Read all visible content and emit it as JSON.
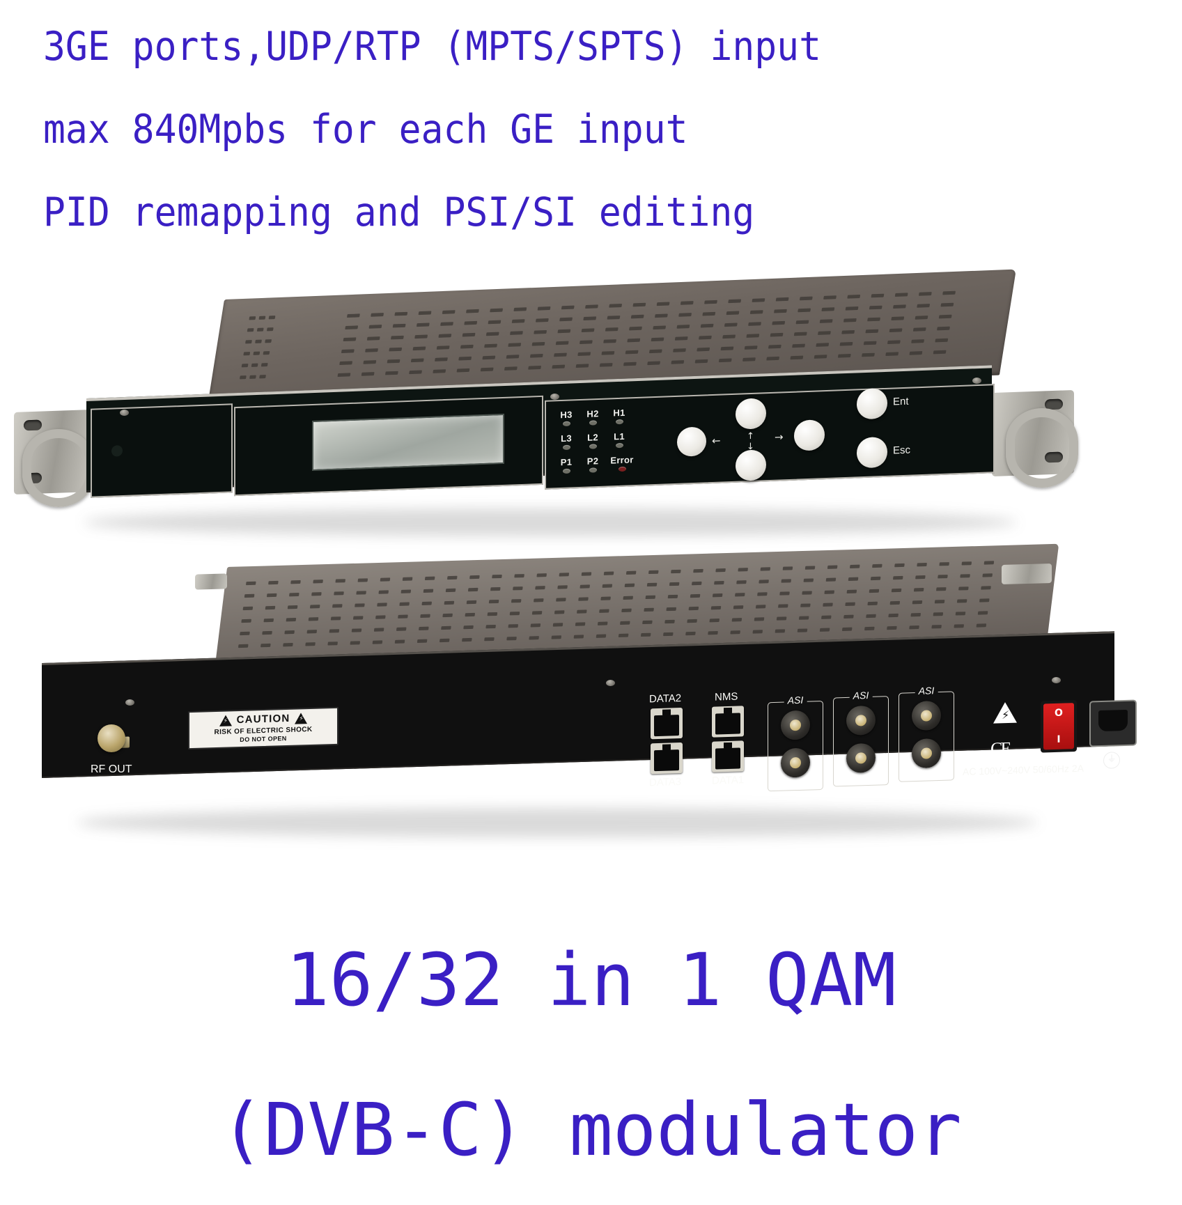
{
  "marketing": {
    "top_lines": [
      "3GE ports,UDP/RTP (MPTS/SPTS) input",
      "max 840Mpbs for each GE input",
      "PID remapping and PSI/SI editing"
    ],
    "bottom_lines": [
      "16/32 in 1 QAM",
      "(DVB-C) modulator"
    ],
    "text_color": "#3a1fc4"
  },
  "front_panel": {
    "leds": {
      "row1": [
        "H3",
        "H2",
        "H1"
      ],
      "row2": [
        "L3",
        "L2",
        "L1"
      ],
      "row3": [
        "P1",
        "P2",
        "Error"
      ],
      "error_color": "#7a1f1f",
      "idle_color": "#6e6f66"
    },
    "buttons": {
      "up": "▲",
      "down": "▼",
      "left": "◀",
      "right": "▶",
      "enter_label": "Ent",
      "escape_label": "Esc"
    },
    "arrows": {
      "left": "←",
      "right": "→",
      "up": "↑",
      "down": "↓"
    }
  },
  "rear_panel": {
    "rf_out_label": "RF OUT",
    "caution": {
      "title": "CAUTION",
      "line1": "RISK OF ELECTRIC SHOCK",
      "line2": "DO NOT OPEN",
      "bolt": "⚡"
    },
    "ethernet_ports": [
      {
        "label": "DATA2",
        "position": "top-left"
      },
      {
        "label": "NMS",
        "position": "top-right"
      },
      {
        "label": "DATA3",
        "position": "bottom-left"
      },
      {
        "label": "DATA1",
        "position": "bottom-right"
      }
    ],
    "asi_groups": [
      {
        "label": "ASI"
      },
      {
        "label": "ASI"
      },
      {
        "label": "ASI"
      }
    ],
    "power": {
      "ac_rating": "AC 100V~240V 50/60Hz 2A",
      "switch_on": "I",
      "switch_off": "O",
      "switch_color": "#d81b1b",
      "ce_mark": "CE",
      "ground_symbol": "⏚",
      "hazard_symbol": "⚡"
    }
  }
}
